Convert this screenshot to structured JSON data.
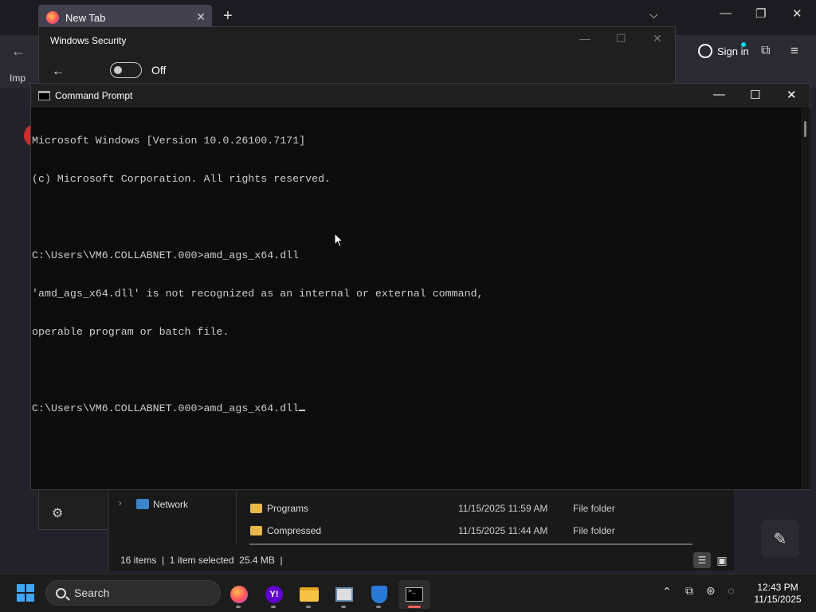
{
  "browser": {
    "tab_title": "New Tab",
    "tab_close": "✕",
    "new_tab": "+",
    "list_tabs": "⌵",
    "min": "—",
    "restore": "❐",
    "close": "✕",
    "back": "←",
    "signin_label": "Sign in",
    "ext": "⧉",
    "menu": "≡",
    "import_label": "Imp",
    "pencil": "✎"
  },
  "windows_security": {
    "title": "Windows Security",
    "min": "—",
    "max": "☐",
    "close": "✕",
    "back": "←",
    "toggle_state": "Off",
    "gear": "⚙"
  },
  "file_explorer": {
    "nav_chevron": "›",
    "network_label": "Network",
    "rows": [
      {
        "name": "Programs",
        "date": "11/15/2025 11:59 AM",
        "type": "File folder"
      },
      {
        "name": "Compressed",
        "date": "11/15/2025 11:44 AM",
        "type": "File folder"
      }
    ],
    "status": "16 items  |  1 item selected  25.4 MB  |",
    "view_details": "☰",
    "view_tiles": "▣"
  },
  "cmd": {
    "title": "Command Prompt",
    "min": "—",
    "max": "☐",
    "close": "✕",
    "lines": [
      "Microsoft Windows [Version 10.0.26100.7171]",
      "(c) Microsoft Corporation. All rights reserved.",
      "",
      "C:\\Users\\VM6.COLLABNET.000>amd_ags_x64.dll",
      "'amd_ags_x64.dll' is not recognized as an internal or external command,",
      "operable program or batch file.",
      "",
      "C:\\Users\\VM6.COLLABNET.000>amd_ags_x64.dll"
    ]
  },
  "taskbar": {
    "search_label": "Search",
    "apps": [
      "firefox-icon",
      "yahoo-icon",
      "file-explorer-icon",
      "news-icon",
      "windows-security-icon",
      "command-prompt-icon"
    ],
    "yahoo_glyph": "Y!",
    "terminal_glyph": ">_",
    "tray_chevron": "⌃",
    "tray_icons": "⧉ ⊛ ◌",
    "time": "12:43 PM",
    "date": "11/15/2025"
  }
}
